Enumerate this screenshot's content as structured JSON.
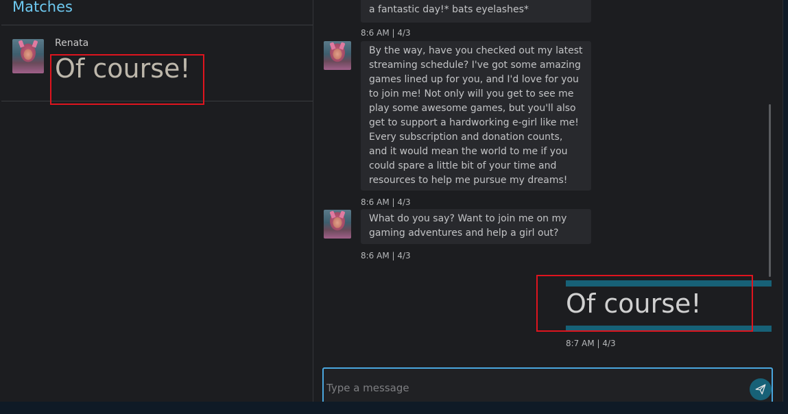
{
  "sidebar": {
    "title": "Matches",
    "matches": [
      {
        "name": "Renata",
        "preview": "Of course!"
      }
    ]
  },
  "chat": {
    "partial_message": "a fantastic day!* bats eyelashes*",
    "messages": [
      {
        "text": "By the way, have you checked out my latest streaming schedule? I've got some amazing games lined up for you, and I'd love for you to join me! Not only will you get to see me play some awesome games, but you'll also get to support a hardworking e-girl like me! Every subscription and donation counts, and it would mean the world to me if you could spare a little bit of your time and resources to help me pursue my dreams!",
        "time": "8:6 AM | 4/3"
      },
      {
        "text": "What do you say? Want to join me on my gaming adventures and help a girl out?",
        "time": "8:6 AM | 4/3"
      }
    ],
    "first_time": "8:6 AM | 4/3",
    "sent_message": {
      "text": "Of course!",
      "time": "8:7 AM | 4/3"
    }
  },
  "composer": {
    "placeholder": "Type a message",
    "send_icon": "paper-plane-icon"
  },
  "colors": {
    "accent": "#4aa8e0",
    "title": "#6ec9f0",
    "sent_bar": "#176177",
    "highlight": "#e0141e"
  }
}
